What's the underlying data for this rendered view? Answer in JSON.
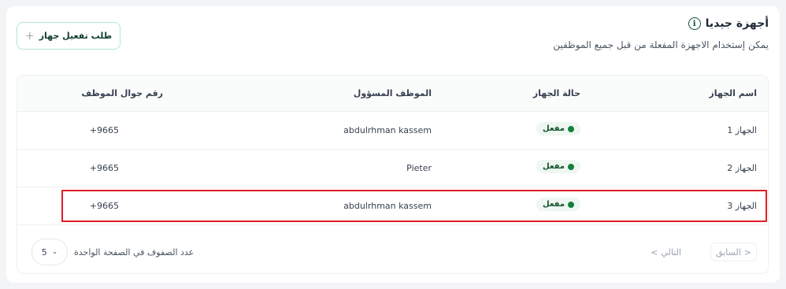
{
  "header": {
    "title": "أجهزة جيديا",
    "info_icon": "info-icon",
    "subtitle": "يمكن إستخدام الاجهزة المفعلة من قبل جميع الموظفين"
  },
  "actions": {
    "request_label": "طلب تفعيل جهاز",
    "request_icon": "plus-icon"
  },
  "table": {
    "columns": [
      "اسم الجهاز",
      "حالة الجهاز",
      "الموظف المسؤول",
      "رقم جوال الموظف"
    ],
    "rows": [
      {
        "device": "الجهاز 1",
        "status": "مفعل",
        "employee": "abdulrhman kassem",
        "phone": "+9665"
      },
      {
        "device": "الجهاز 2",
        "status": "مفعل",
        "employee": "Pieter",
        "phone": "+9665"
      },
      {
        "device": "الجهاز 3",
        "status": "مفعل",
        "employee": "abdulrhman kassem",
        "phone": "+9665"
      }
    ],
    "status_color": "#15803d"
  },
  "pagination": {
    "prev_label": "السابق",
    "next_label": "التالي",
    "rows_per_page_label": "عدد الصفوف في الصفحة الواحدة",
    "rows_per_page_value": "5"
  },
  "highlight_color": "#e11d24"
}
